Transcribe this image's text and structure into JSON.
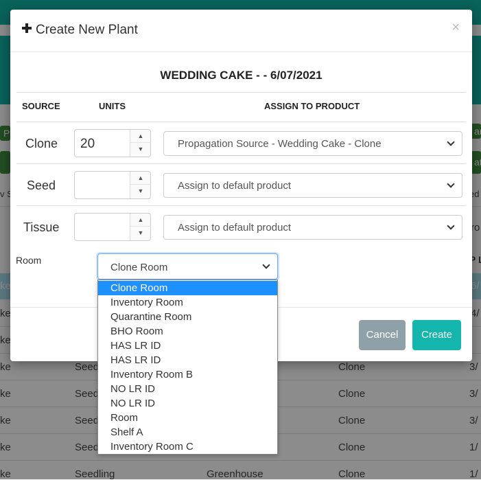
{
  "background": {
    "left_fragments": [
      "Pr",
      "v S",
      "ke",
      "ke",
      "ke",
      "ke",
      "ke",
      "ke",
      "ke",
      "ke"
    ],
    "right_fragments": [
      "an",
      "ato",
      "ed",
      "ro",
      "P L",
      "6/",
      "4/",
      "3/",
      "3/",
      "3/",
      "1/",
      "1/",
      "1/"
    ],
    "rows": [
      {
        "type": "Seedl",
        "source": "Clone"
      },
      {
        "type": "Seedl",
        "source": "Clone"
      },
      {
        "type": "Seedl",
        "source": "Clone"
      },
      {
        "type": "Seedl",
        "source": "Clone"
      },
      {
        "type": "Seedling",
        "location": "Greenhouse",
        "source": "Clone"
      }
    ]
  },
  "modal": {
    "title": "Create New Plant",
    "close": "×",
    "subtitle": "WEDDING CAKE - - 6/07/2021",
    "columns": [
      "SOURCE",
      "UNITS",
      "ASSIGN TO PRODUCT"
    ],
    "rows": [
      {
        "source": "Clone",
        "units": "20",
        "product": "Propagation Source - Wedding Cake - Clone"
      },
      {
        "source": "Seed",
        "units": "",
        "product": "Assign to default product"
      },
      {
        "source": "Tissue",
        "units": "",
        "product": "Assign to default product"
      }
    ],
    "room_label": "Room",
    "room_value": "Clone Room",
    "cancel": "Cancel",
    "create": "Create"
  },
  "room_options": [
    "Clone Room",
    "Inventory Room",
    "Quarantine Room",
    "BHO Room",
    "HAS LR ID",
    "HAS LR ID",
    "Inventory Room B",
    "NO LR ID",
    "NO LR ID",
    "Room",
    "Shelf A",
    "Inventory Room C"
  ],
  "colors": {
    "teal": "#12b5a6",
    "create_button": "#14b5ad",
    "cancel_button": "#8fa1a8",
    "selected_option": "#1e90ff"
  }
}
